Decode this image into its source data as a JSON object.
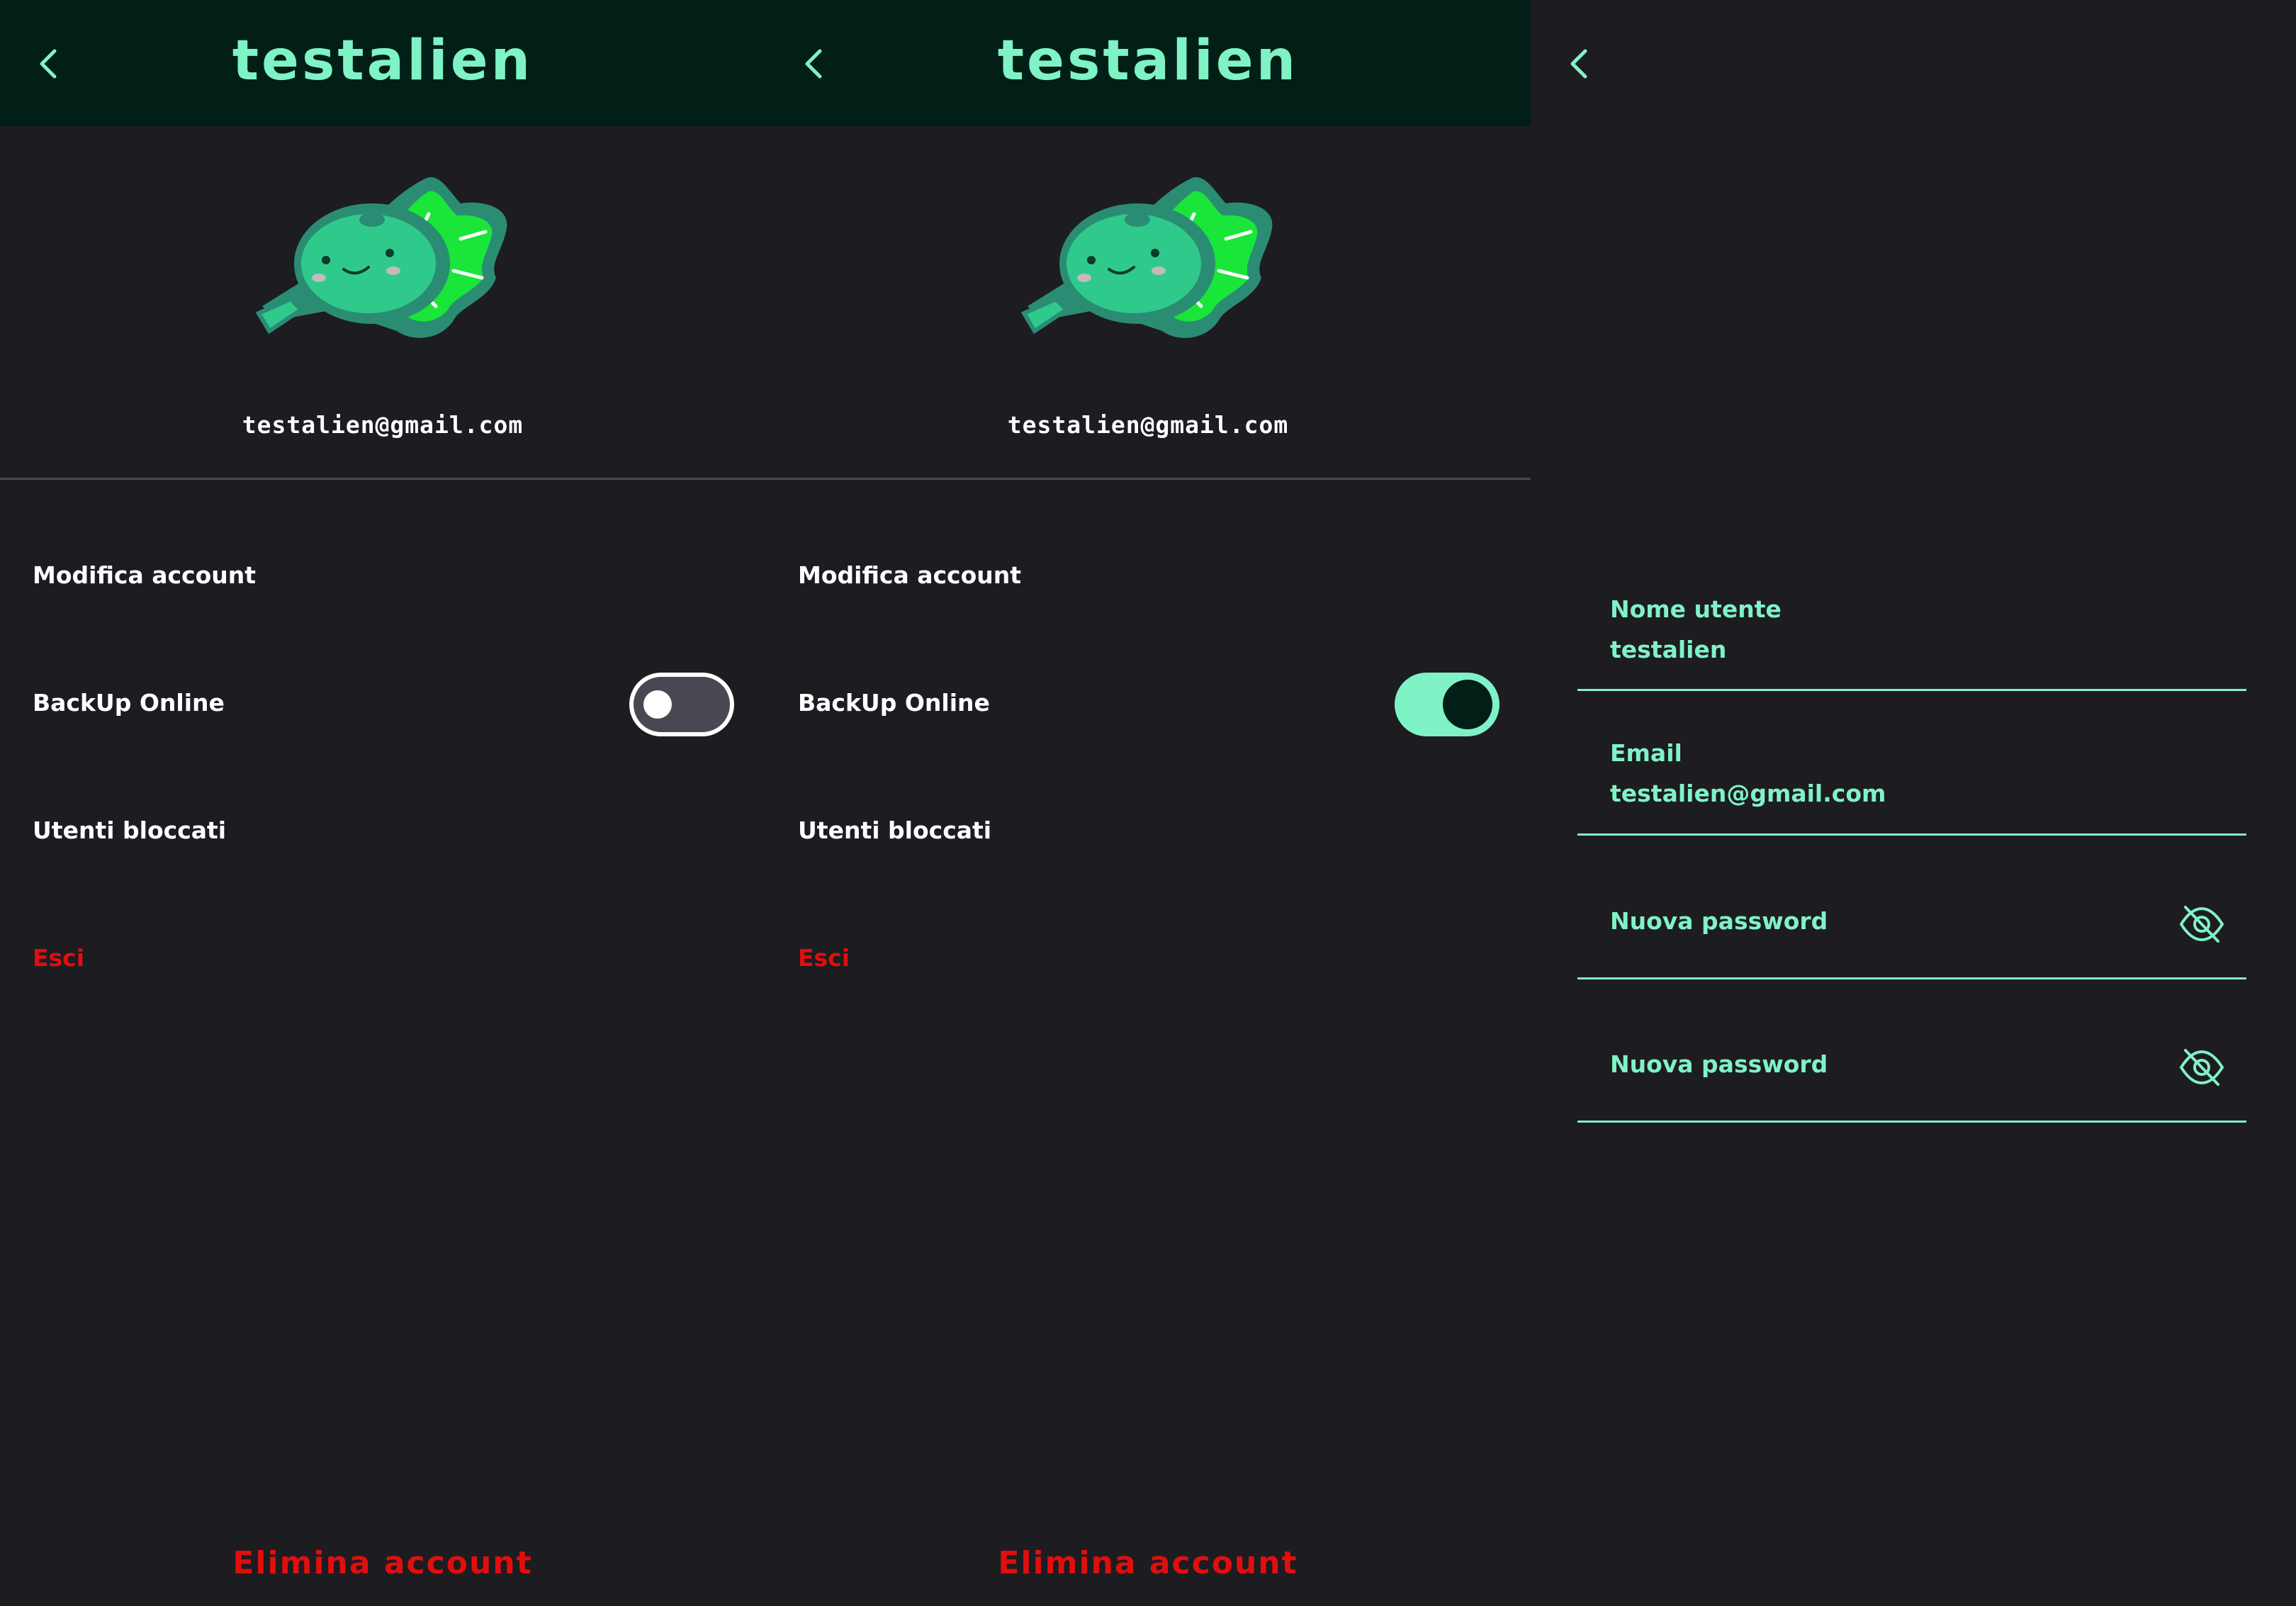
{
  "colors": {
    "background": "#1d1c21",
    "appbar": "#011f17",
    "accent": "#7ff2c6",
    "danger": "#e10e0e",
    "text": "#ffffff"
  },
  "app": {
    "title": "testalien"
  },
  "profile": {
    "email": "testalien@gmail.com"
  },
  "menu": {
    "edit_account": "Modifica account",
    "backup_online": "BackUp Online",
    "blocked_users": "Utenti bloccati",
    "logout": "Esci"
  },
  "delete_account": "Elimina account",
  "backup_states": {
    "panel1": false,
    "panel2": true
  },
  "edit_form": {
    "username_label": "Nome utente",
    "username_value": "testalien",
    "email_label": "Email",
    "email_value": "testalien@gmail.com",
    "new_password_label": "Nuova password",
    "confirm_password_label": "Nuova password"
  },
  "icons": {
    "back": "chevron-left-icon",
    "avatar": "alien-leaf-mascot",
    "visibility": "eye-off-icon"
  }
}
